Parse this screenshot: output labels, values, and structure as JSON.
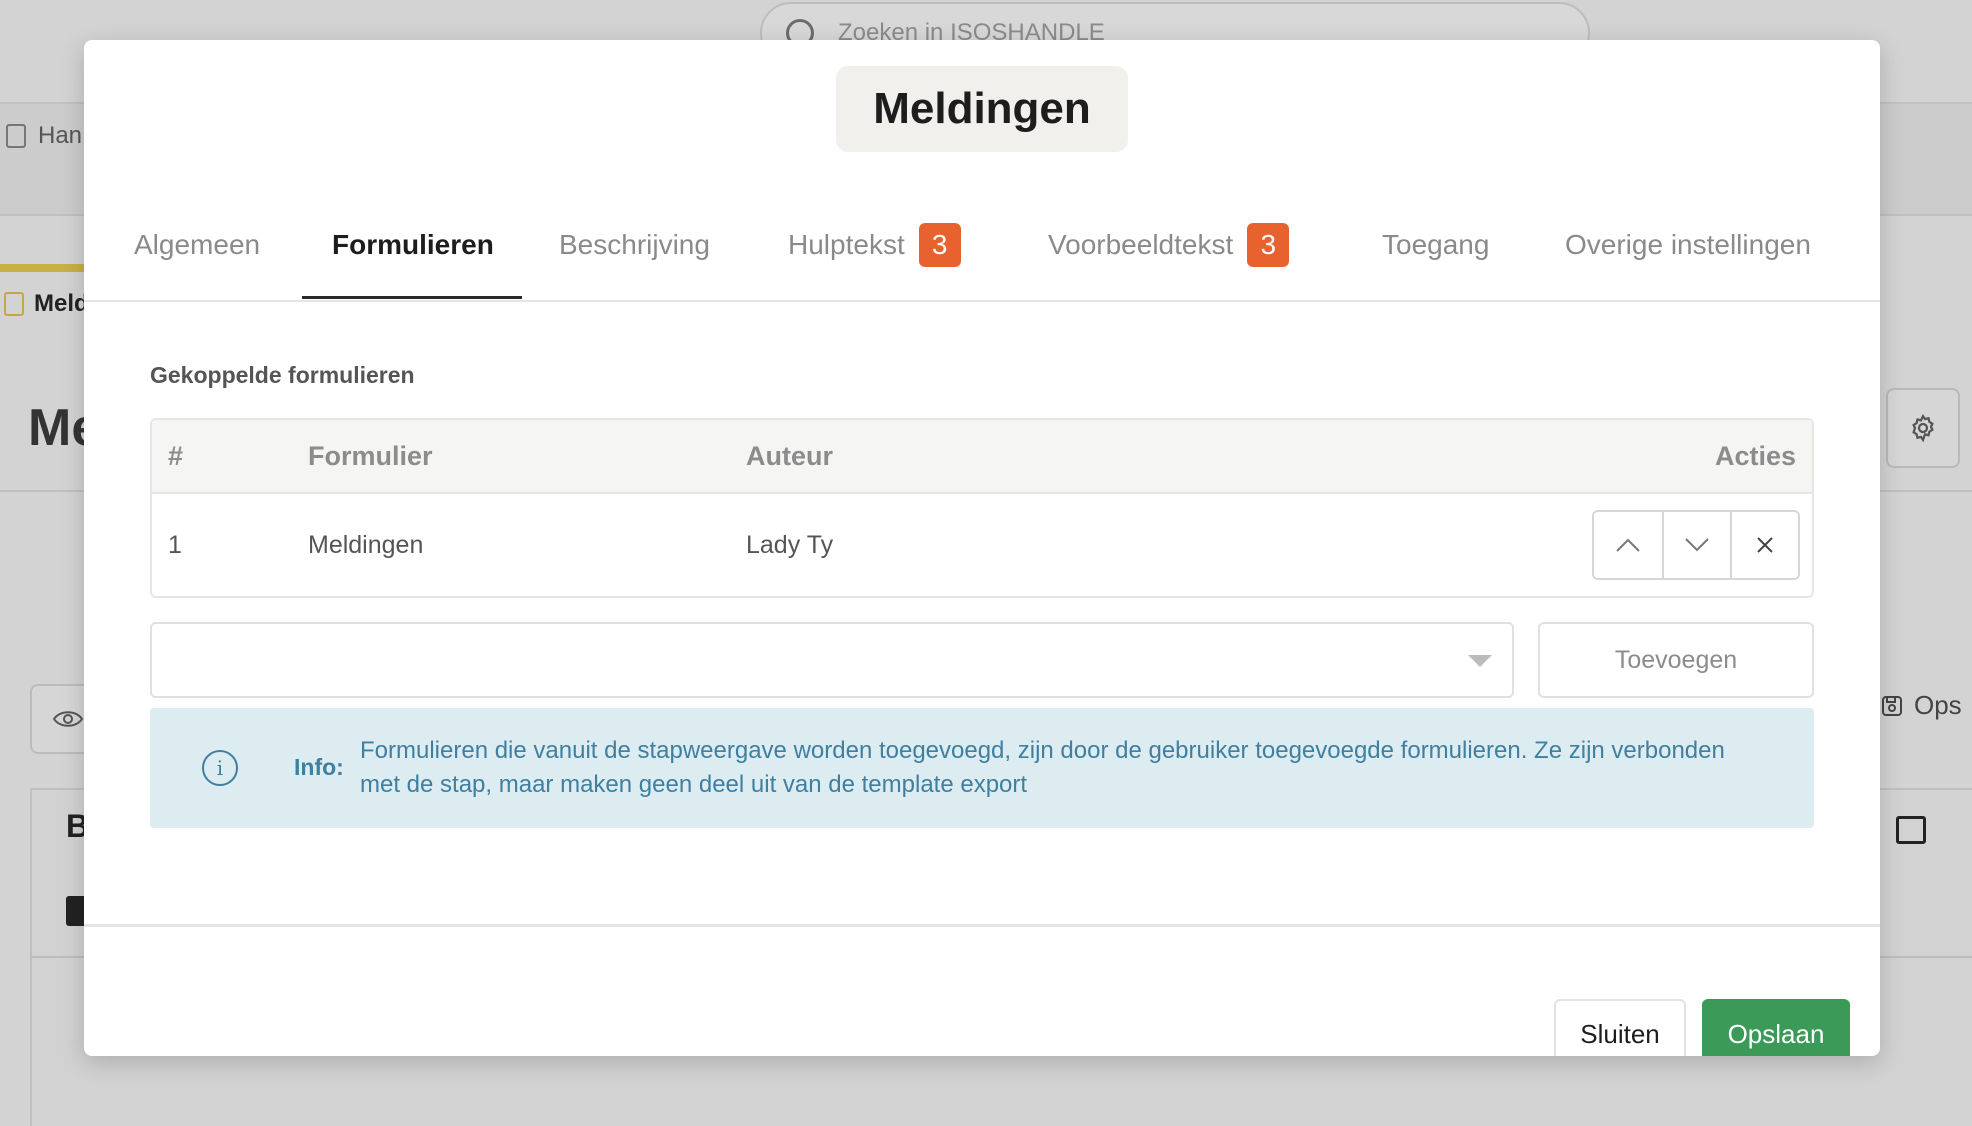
{
  "background": {
    "search_placeholder": "Zoeken in ISOSHANDLE",
    "tab_label": "Han",
    "breadcrumb": "Meld",
    "page_title": "Me",
    "b_text": "B",
    "save_text": "Ops",
    "icons": {
      "search": "search-icon",
      "gear": "gear-icon",
      "eye": "eye-icon",
      "save": "save-icon",
      "image": "image-icon",
      "document": "document-icon"
    }
  },
  "modal": {
    "title": "Meldingen",
    "tabs": [
      {
        "label": "Algemeen",
        "active": false
      },
      {
        "label": "Formulieren",
        "active": true
      },
      {
        "label": "Beschrijving",
        "active": false
      },
      {
        "label": "Hulptekst",
        "badge": "3",
        "active": false
      },
      {
        "label": "Voorbeeldtekst",
        "badge": "3",
        "active": false
      },
      {
        "label": "Toegang",
        "active": false
      },
      {
        "label": "Overige instellingen",
        "active": false
      }
    ],
    "section_label": "Gekoppelde formulieren",
    "table": {
      "headers": {
        "num": "#",
        "form": "Formulier",
        "author": "Auteur",
        "actions": "Acties"
      },
      "rows": [
        {
          "num": "1",
          "form": "Meldingen",
          "author": "Lady Ty"
        }
      ],
      "action_icons": [
        "chevron-up-icon",
        "chevron-down-icon",
        "close-icon"
      ]
    },
    "select": {
      "value": ""
    },
    "add_button": "Toevoegen",
    "info": {
      "label": "Info:",
      "text": "Formulieren die vanuit de stapweergave worden toegevoegd, zijn door de gebruiker toegevoegde formulieren. Ze zijn verbonden met de stap, maar maken geen deel uit van de template export",
      "icon": "info-icon"
    },
    "footer": {
      "close_label": "Sluiten",
      "save_label": "Opslaan"
    }
  },
  "colors": {
    "accent_badge": "#e8622f",
    "save_button": "#3c9a59",
    "info_bg": "#dcecf1",
    "info_text": "#3f7fa0"
  }
}
